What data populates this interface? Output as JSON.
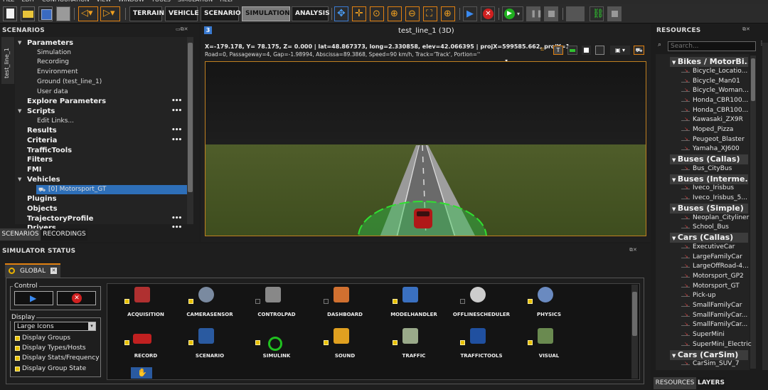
{
  "menu": [
    "FILE",
    "EDIT",
    "CONFIGURATION",
    "VIEW",
    "WINDOW",
    "TOOLS",
    "SIMULATION",
    "HELP"
  ],
  "toolbar": {
    "terrain": "TERRAIN",
    "vehicle": "VEHICLE",
    "scenario": "SCENARIO",
    "simulation": "SIMULATION",
    "analysis": "ANALYSIS"
  },
  "scenarios_panel": {
    "title": "SCENARIOS",
    "side_tab": "test_line_1",
    "tree": [
      {
        "label": "Parameters",
        "level": 0
      },
      {
        "label": "Simulation",
        "level": 1
      },
      {
        "label": "Recording",
        "level": 1
      },
      {
        "label": "Environment",
        "level": 1
      },
      {
        "label": "Ground (test_line_1)",
        "level": 1
      },
      {
        "label": "User data",
        "level": 1
      },
      {
        "label": "Explore Parameters",
        "level": 0
      },
      {
        "label": "Scripts",
        "level": 0
      },
      {
        "label": "Edit Links...",
        "level": 1
      },
      {
        "label": "Results",
        "level": 0
      },
      {
        "label": "Criteria",
        "level": 0
      },
      {
        "label": "TrafficTools",
        "level": 0
      },
      {
        "label": "Filters",
        "level": 0
      },
      {
        "label": "FMI",
        "level": 0
      },
      {
        "label": "Vehicles",
        "level": 0
      },
      {
        "label": "[0] Motorsport_GT",
        "level": 2
      },
      {
        "label": "Plugins",
        "level": 0
      },
      {
        "label": "Objects",
        "level": 0
      },
      {
        "label": "TrajectoryProfile",
        "level": 0
      },
      {
        "label": "Drivers",
        "level": 0
      }
    ],
    "tabs": [
      "SCENARIOS",
      "RECORDINGS"
    ]
  },
  "viewport": {
    "title": "test_line_1 (3D)",
    "info_line1": "X=-179.178, Y=  78.175, Z=  0.000 | lat=48.867373, long=2.330858, elev=42.066395 | projX=599585.662, projY=1",
    "info_line2": "Road=0, Passageway=4, Gap=-1.98994, Abscissa=89.3868, Speed=90 km/h, Track='Track', Portion=''"
  },
  "resources": {
    "title": "RESOURCES",
    "search_placeholder": "Search...",
    "categories": [
      {
        "name": "Bikes / MotorBi...",
        "items": [
          "Bicycle_Locatio...",
          "Bicycle_Man01",
          "Bicycle_Woman...",
          "Honda_CBR100...",
          "Honda_CBR100...",
          "Kawasaki_ZX9R",
          "Moped_Pizza",
          "Peugeot_Blaster",
          "Yamaha_XJ600"
        ]
      },
      {
        "name": "Buses (Callas)",
        "items": [
          "Bus_CityBus"
        ]
      },
      {
        "name": "Buses (Interme...",
        "items": [
          "Iveco_Irisbus",
          "Iveco_Irisbus_5..."
        ]
      },
      {
        "name": "Buses (Simple)",
        "items": [
          "Neoplan_Cityliner",
          "School_Bus"
        ]
      },
      {
        "name": "Cars (Callas)",
        "items": [
          "ExecutiveCar",
          "LargeFamilyCar",
          "LargeOffRoad-4...",
          "Motorsport_GP2",
          "Motorsport_GT",
          "Pick-up",
          "SmallFamilyCar",
          "SmallFamilyCar...",
          "SmallFamilyCar...",
          "SuperMini",
          "SuperMini_Electric"
        ]
      },
      {
        "name": "Cars (CarSim)",
        "items": [
          "CarSim_SUV_7"
        ]
      }
    ],
    "tabs": [
      "RESOURCES",
      "LAYERS"
    ]
  },
  "sim_status": {
    "title": "SIMULATOR STATUS",
    "group_tab": "GLOBAL",
    "control_label": "Control",
    "display_label": "Display",
    "display_select": "Large Icons",
    "display_options": [
      "Display Groups",
      "Display Types/Hosts",
      "Display Stats/Frequency",
      "Display Group State"
    ],
    "modules": [
      {
        "name": "ACQUISITION",
        "checked": true,
        "icon": "seat-icon",
        "color": "#b03030"
      },
      {
        "name": "CAMERASENSOR",
        "checked": true,
        "icon": "camera-icon",
        "color": "#7a8aa0"
      },
      {
        "name": "CONTROLPAD",
        "checked": false,
        "icon": "controlpad-icon",
        "color": "#888888"
      },
      {
        "name": "DASHBOARD",
        "checked": false,
        "icon": "gauge-icon",
        "color": "#d07030"
      },
      {
        "name": "MODELHANDLER",
        "checked": true,
        "icon": "car-model-icon",
        "color": "#3a70c0"
      },
      {
        "name": "OFFLINESCHEDULER",
        "checked": false,
        "icon": "stopwatch-icon",
        "color": "#cccccc"
      },
      {
        "name": "PHYSICS",
        "checked": true,
        "icon": "physics-icon",
        "color": "#6a8ac0"
      },
      {
        "name": "RECORD",
        "checked": true,
        "icon": "record-icon",
        "color": "#c02020"
      },
      {
        "name": "SCENARIO",
        "checked": true,
        "icon": "scenario-doc-icon",
        "color": "#2a5aa0"
      },
      {
        "name": "SIMULINK",
        "checked": true,
        "icon": "simulink-icon",
        "color": "#20c020"
      },
      {
        "name": "SOUND",
        "checked": true,
        "icon": "music-icon",
        "color": "#e0a020"
      },
      {
        "name": "TRAFFIC",
        "checked": true,
        "icon": "traffic-icon",
        "color": "#9aaa8a"
      },
      {
        "name": "TRAFFICTOOLS",
        "checked": true,
        "icon": "traffictools-icon",
        "color": "#2050a0"
      },
      {
        "name": "VISUAL",
        "checked": true,
        "icon": "visual-icon",
        "color": "#6a8a50"
      }
    ]
  }
}
